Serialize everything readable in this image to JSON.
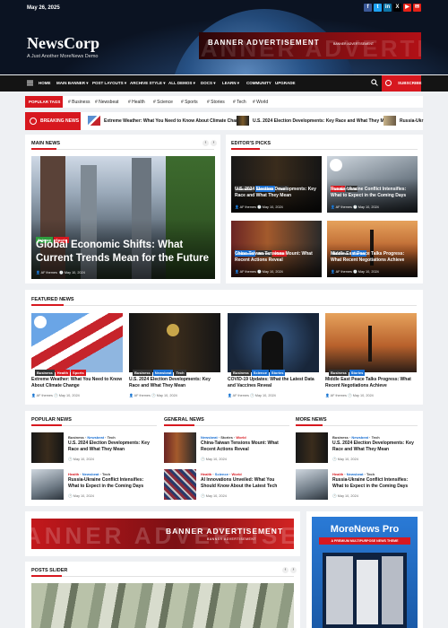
{
  "header": {
    "date": "May 26, 2025",
    "logo": "NewsCorp",
    "tagline": "A Just Another MoreNews Demo",
    "banner_title": "BANNER ADVERTISEMENT",
    "banner_sub": "BANNER ADVERTISEMENT",
    "banner_bg_text": "BANNER ADVERTISEMENT",
    "socials": [
      {
        "label": "f",
        "icon": "facebook-icon",
        "color": "#3b5998"
      },
      {
        "label": "t",
        "icon": "twitter-icon",
        "color": "#1da1f2"
      },
      {
        "label": "in",
        "icon": "linkedin-icon",
        "color": "#0e76a8"
      },
      {
        "label": "X",
        "icon": "x-icon",
        "color": "#000000"
      },
      {
        "label": "▶",
        "icon": "youtube-icon",
        "color": "#e62117"
      },
      {
        "label": "✉",
        "icon": "mail-icon",
        "color": "#e62117"
      }
    ]
  },
  "nav": {
    "items": [
      "HOME",
      "MAIN BANNER ▾",
      "POST LAYOUTS ▾",
      "ARCHIVE STYLE ▾",
      "ALL DEMOS ▾",
      "DOCS ▾",
      "LEARN ▾",
      "COMMUNITY",
      "UPGRADE"
    ],
    "subscribe": "SUBSCRIBE"
  },
  "popular_tags": {
    "label": "POPULAR TAGS",
    "tags": [
      "# Business",
      "# Newsbeat",
      "# Health",
      "# Science",
      "# Sports",
      "# Stories",
      "# Tech",
      "# World"
    ]
  },
  "breaking": {
    "label": "BREAKING NEWS",
    "items": [
      "Extreme Weather: What You Need to Know About Climate Change",
      "U.S. 2024 Election Developments: Key Race and What They Mean",
      "Russia-Ukr"
    ]
  },
  "main_news": {
    "title": "MAIN NEWS",
    "cats": [
      "Science",
      "Sports"
    ],
    "headline": "Global Economic Shifts: What Current Trends Mean for the Future",
    "author": "AF themes",
    "date": "May 10, 2024"
  },
  "editors_picks": {
    "title": "EDITOR'S PICKS",
    "items": [
      {
        "cats": [
          "Business",
          "Newsbeat",
          "Tech"
        ],
        "title": "U.S. 2024 Election Developments: Key Race and What They Mean",
        "author": "AF themes",
        "date": "May 10, 2024"
      },
      {
        "cats": [
          "Health",
          "Tech"
        ],
        "title": "Russia-Ukraine Conflict Intensifies: What to Expect in the Coming Days",
        "author": "AF themes",
        "date": "May 10, 2024"
      },
      {
        "cats": [
          "Newsbeat",
          "Stories",
          "World"
        ],
        "title": "China-Taiwan Tensions Mount: What Recent Actions Reveal",
        "author": "AF themes",
        "date": "May 10, 2024"
      },
      {
        "cats": [
          "Business",
          "Stories"
        ],
        "title": "Middle East Peace Talks Progress: What Recent Negotiations Achieve",
        "author": "AF themes",
        "date": "May 10, 2024"
      }
    ]
  },
  "featured": {
    "title": "FEATURED NEWS",
    "items": [
      {
        "cats": [
          "Business",
          "Health",
          "Sports"
        ],
        "title": "Extreme Weather: What You Need to Know About Climate Change",
        "author": "AF themes",
        "date": "May 10, 2024"
      },
      {
        "cats": [
          "Business",
          "Newsbeat",
          "Tech"
        ],
        "title": "U.S. 2024 Election Developments: Key Race and What They Mean",
        "author": "AF themes",
        "date": "May 10, 2024"
      },
      {
        "cats": [
          "Business",
          "Science",
          "Stories"
        ],
        "title": "COVID-19 Updates: What the Latest Data and Vaccines Reveal",
        "author": "AF themes",
        "date": "May 10, 2024"
      },
      {
        "cats": [
          "Business",
          "Stories"
        ],
        "title": "Middle East Peace Talks Progress: What Recent Negotiations Achieve",
        "author": "AF themes",
        "date": "May 10, 2024"
      }
    ]
  },
  "popular_news": {
    "title": "POPULAR NEWS",
    "items": [
      {
        "cats": [
          "Business",
          "Newsbeat",
          "Tech"
        ],
        "title": "U.S. 2024 Election Developments: Key Race and What They Mean",
        "date": "May 10, 2024"
      },
      {
        "cats": [
          "Health",
          "Newsbeat",
          "Tech"
        ],
        "title": "Russia-Ukraine Conflict Intensifies: What to Expect in the Coming Days",
        "date": "May 10, 2024"
      }
    ]
  },
  "general_news": {
    "title": "GENERAL NEWS",
    "items": [
      {
        "cats": [
          "Newsbeat",
          "Stories",
          "World"
        ],
        "title": "China-Taiwan Tensions Mount: What Recent Actions Reveal",
        "date": "May 10, 2024"
      },
      {
        "cats": [
          "Health",
          "Science",
          "World"
        ],
        "title": "AI Innovations Unveiled: What You Should Know About the Latest Tech",
        "date": "May 10, 2024"
      }
    ]
  },
  "more_news": {
    "title": "MORE NEWS",
    "items": [
      {
        "cats": [
          "Business",
          "Newsbeat",
          "Tech"
        ],
        "title": "U.S. 2024 Election Developments: Key Race and What They Mean",
        "date": "May 10, 2024"
      },
      {
        "cats": [
          "Health",
          "Newsbeat",
          "Tech"
        ],
        "title": "Russia-Ukraine Conflict Intensifies: What to Expect in the Coming Days",
        "date": "May 10, 2024"
      }
    ]
  },
  "ad": {
    "title": "BANNER ADVERTISEMENT",
    "sub": "BANNER ADVERTISEMENT",
    "bg_text": "ANNER ADVERTISEMENT"
  },
  "promo": {
    "title": "MoreNews Pro",
    "sub": "A PREMIUM MULTIPURPOSE NEWS THEME"
  },
  "posts_slider": {
    "title": "POSTS SLIDER"
  },
  "colors": {
    "accent": "#d7181f",
    "cat_business": "#333333",
    "cat_blue": "#1a6fd1",
    "cat_red": "#d7181f",
    "cat_green": "#2e9e3e"
  }
}
